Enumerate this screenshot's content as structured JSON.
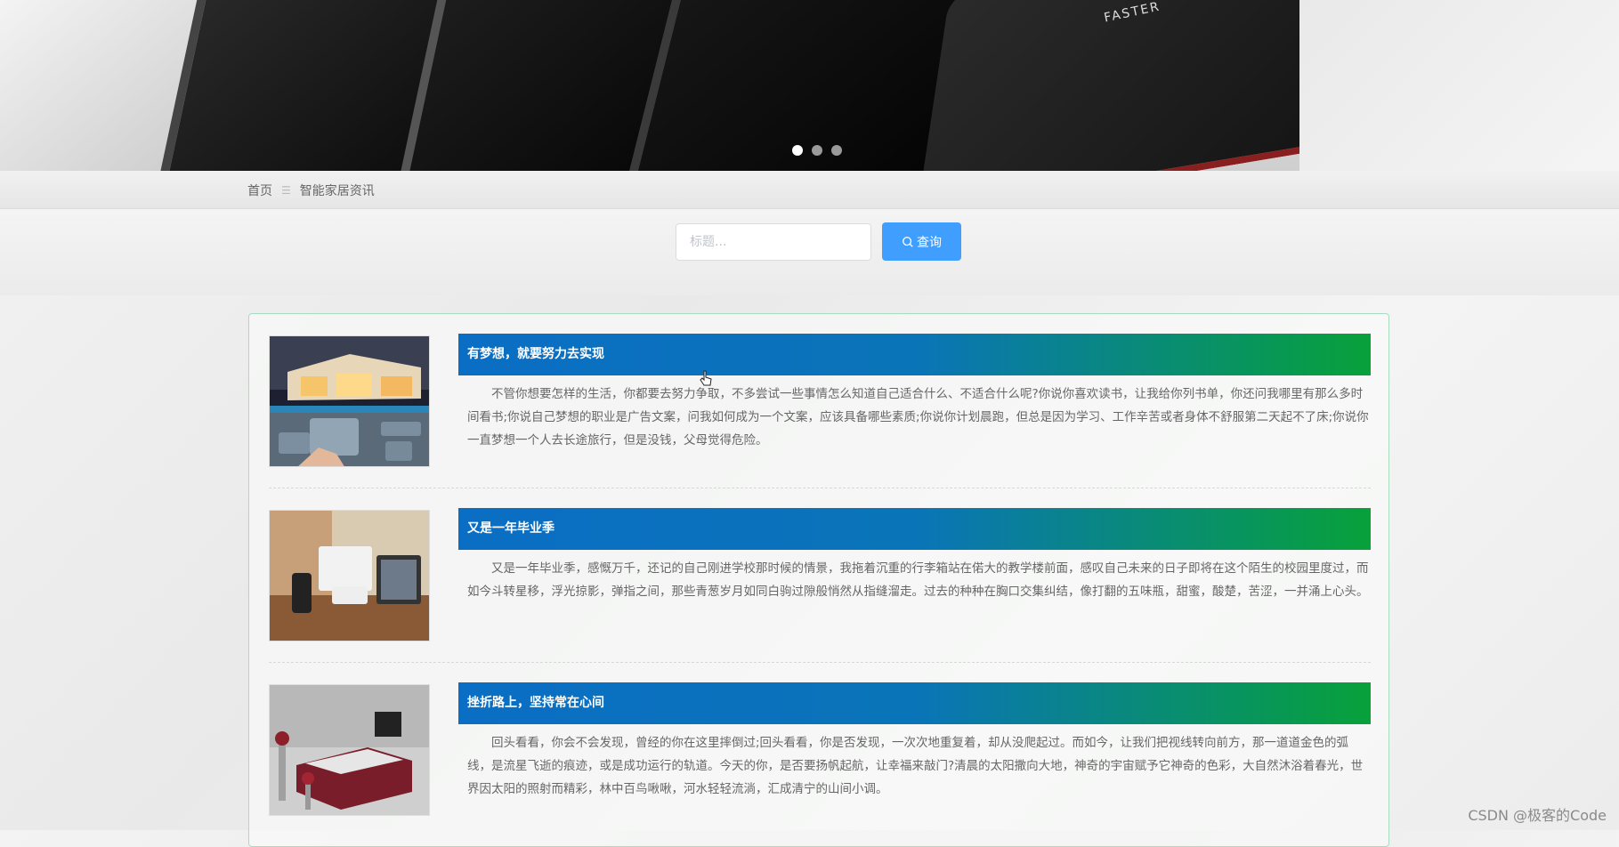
{
  "banner": {
    "text": "FASTER",
    "dots": [
      {
        "active": true
      },
      {
        "active": false
      },
      {
        "active": false
      }
    ]
  },
  "breadcrumb": {
    "home": "首页",
    "separator": "☰",
    "current": "智能家居资讯"
  },
  "search": {
    "placeholder": "标题...",
    "value": "",
    "button_label": "查询"
  },
  "news": [
    {
      "title": "有梦想，就要努力去实现",
      "desc": "不管你想要怎样的生活，你都要去努力争取，不多尝试一些事情怎么知道自己适合什么、不适合什么呢?你说你喜欢读书，让我给你列书单，你还问我哪里有那么多时间看书;你说自己梦想的职业是广告文案，问我如何成为一个文案，应该具备哪些素质;你说你计划晨跑，但总是因为学习、工作辛苦或者身体不舒服第二天起不了床;你说你一直梦想一个人去长途旅行，但是没钱，父母觉得危险。"
    },
    {
      "title": "又是一年毕业季",
      "desc": "又是一年毕业季，感慨万千，还记的自己刚进学校那时候的情景，我拖着沉重的行李箱站在偌大的教学楼前面，感叹自己未来的日子即将在这个陌生的校园里度过，而如今斗转星移，浮光掠影，弹指之间，那些青葱岁月如同白驹过隙般悄然从指缝溜走。过去的种种在胸口交集纠结，像打翻的五味瓶，甜蜜，酸楚，苦涩，一并涌上心头。"
    },
    {
      "title": "挫折路上，坚持常在心间",
      "desc": "回头看看，你会不会发现，曾经的你在这里摔倒过;回头看看，你是否发现，一次次地重复着，却从没爬起过。而如今，让我们把视线转向前方，那一道道金色的弧线，是流星飞逝的痕迹，或是成功运行的轨道。今天的你，是否要扬帆起航，让幸福来敲门?清晨的太阳撒向大地，神奇的宇宙赋予它神奇的色彩，大自然沐浴着春光，世界因太阳的照射而精彩，林中百鸟啾啾，河水轻轻流淌，汇成清宁的山间小调。"
    }
  ],
  "watermark": "CSDN @极客的Code"
}
